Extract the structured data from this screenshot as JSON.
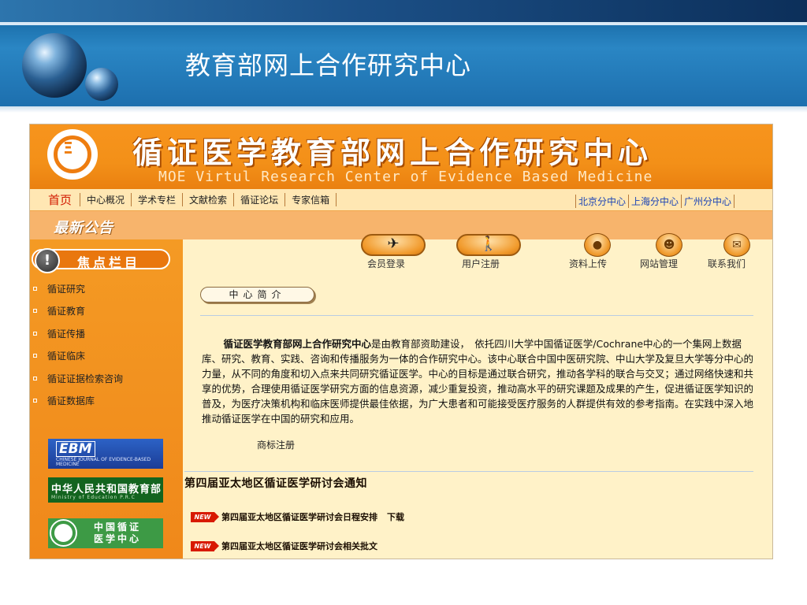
{
  "slide": {
    "title": "教育部网上合作研究中心"
  },
  "site": {
    "title_cn": "循证医学教育部网上合作研究中心",
    "title_en": "MOE Virtul Research Center of Evidence Based Medicine",
    "nav": {
      "home": "首页",
      "items": [
        "中心概况",
        "学术专栏",
        "文献检索",
        "循证论坛",
        "专家信箱"
      ],
      "branches": [
        "北京分中心",
        "上海分中心",
        "广州分中心"
      ]
    },
    "news_label": "最新公告",
    "sidebar": {
      "focus_title": "焦点栏目",
      "focus_icon_glyph": "!",
      "items": [
        "循证研究",
        "循证教育",
        "循证传播",
        "循证临床",
        "循证证据检索咨询",
        "循证数据库"
      ],
      "logos": {
        "ebm_title": "EBM",
        "ebm_subtitle": "CHINESE JOURNAL OF EVIDENCE-BASED MEDICINE",
        "moe_cn": "中华人民共和国教育部",
        "moe_en": "Ministry of Education P.R.C",
        "cebm": "中国循证医学中心"
      }
    },
    "actions": {
      "login": {
        "label": "会员登录",
        "glyph": "✈"
      },
      "register": {
        "label": "用户注册",
        "glyph": "🚶"
      },
      "upload": {
        "label": "资料上传",
        "glyph": "●"
      },
      "admin": {
        "label": "网站管理",
        "glyph": "☻"
      },
      "contact": {
        "label": "联系我们",
        "glyph": "✉"
      }
    },
    "intro_tab": "中心简介",
    "intro": {
      "bold": "循证医学教育部网上合作研究中心",
      "body": "是由教育部资助建设，　依托四川大学中国循证医学/Cochrane中心的一个集网上数据库、研究、教育、实践、咨询和传播服务为一体的合作研究中心。该中心联合中国中医研究院、中山大学及复旦大学等分中心的力量，从不同的角度和切入点来共同研究循证医学。中心的目标是通过联合研究，推动各学科的联合与交叉；通过网络快速和共享的优势，合理使用循证医学研究方面的信息资源，减少重复投资，推动高水平的研究课题及成果的产生，促进循证医学知识的普及，为医疗决策机构和临床医师提供最佳依据，为广大患者和可能接受医疗服务的人群提供有效的参考指南。在实践中深入地推动循证医学在中国的研究和应用。"
    },
    "trademark": "商标注册",
    "conference_title": "第四届亚太地区循证医学研讨会通知",
    "new_badge": "NEW",
    "news": [
      {
        "text": "第四届亚太地区循证医学研讨会日程安排",
        "extra": "下载"
      },
      {
        "text": "第四届亚太地区循证医学研讨会相关批文",
        "extra": ""
      }
    ]
  }
}
